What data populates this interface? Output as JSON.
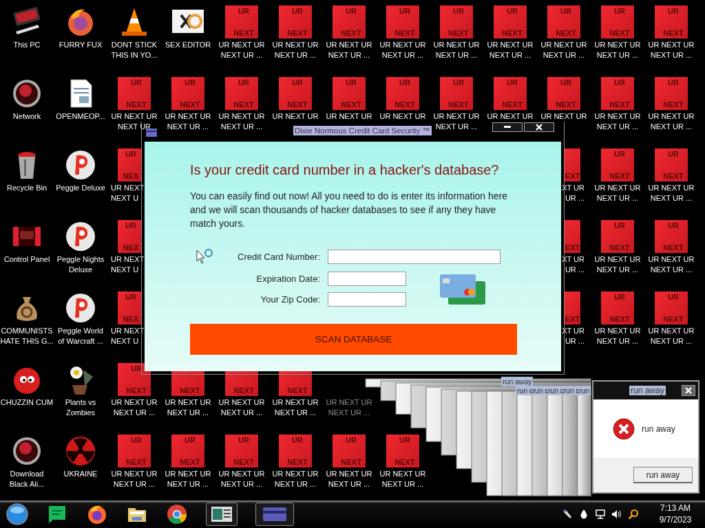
{
  "desktop": {
    "rows": [
      [
        {
          "kind": "pc",
          "label": "This PC"
        },
        {
          "kind": "fox",
          "label": "FURRY FUX"
        },
        {
          "kind": "cone",
          "label": "DONT STICK THIS IN YO..."
        },
        {
          "kind": "hxd",
          "label": "SEX EDITOR"
        },
        {
          "kind": "tile",
          "top": "UR",
          "bottom": "NEXT",
          "label": "UR NEXT UR NEXT UR ..."
        },
        {
          "kind": "tile",
          "top": "UR",
          "bottom": "NEXT",
          "label": "UR NEXT UR NEXT UR ..."
        },
        {
          "kind": "tile",
          "top": "UR",
          "bottom": "NEXT",
          "label": "UR NEXT UR NEXT UR ..."
        },
        {
          "kind": "tile",
          "top": "UR",
          "bottom": "NEXT",
          "label": "UR NEXT UR NEXT UR ..."
        },
        {
          "kind": "tile",
          "top": "UR",
          "bottom": "NEXT",
          "label": "UR NEXT UR NEXT UR ..."
        },
        {
          "kind": "tile",
          "top": "UR",
          "bottom": "NEXT",
          "label": "UR NEXT UR NEXT UR ..."
        },
        {
          "kind": "tile",
          "top": "UR",
          "bottom": "NEXT",
          "label": "UR NEXT UR NEXT UR ..."
        },
        {
          "kind": "tile",
          "top": "UR",
          "bottom": "NEXT",
          "label": "UR NEXT UR NEXT UR ..."
        },
        {
          "kind": "tile",
          "top": "UR",
          "bottom": "NEXT",
          "label": "UR NEXT UR NEXT UR ..."
        }
      ],
      [
        {
          "kind": "orb",
          "label": "Network"
        },
        {
          "kind": "doc",
          "label": "OPENMEOP..."
        },
        {
          "kind": "tile",
          "top": "UR",
          "bottom": "NEXT",
          "label": "UR NEXT UR NEXT UR"
        },
        {
          "kind": "tile",
          "top": "UR",
          "bottom": "NEXT",
          "label": "UR NEXT UR NEXT UR ..."
        },
        {
          "kind": "tile",
          "top": "UR",
          "bottom": "NEXT",
          "label": "UR NEXT UR NEXT UR ..."
        },
        {
          "kind": "tile",
          "top": "UR",
          "bottom": "NEXT",
          "label": "UR NEXT UR"
        },
        {
          "kind": "tile",
          "top": "UR",
          "bottom": "NEXT",
          "label": "UR NEXT UR"
        },
        {
          "kind": "tile",
          "top": "UR",
          "bottom": "NEXT",
          "label": "UR NEXT UR"
        },
        {
          "kind": "tile",
          "top": "UR",
          "bottom": "NEXT",
          "label": "UR NEXT UR NEXT UR ..."
        },
        {
          "kind": "tile",
          "top": "UR",
          "bottom": "NEXT",
          "label": "UR NEXT UR"
        },
        {
          "kind": "tile",
          "top": "UR",
          "bottom": "NEXT",
          "label": "UR NEXT UR"
        },
        {
          "kind": "tile",
          "top": "UR",
          "bottom": "NEXT",
          "label": "UR NEXT UR NEXT UR ..."
        },
        {
          "kind": "tile",
          "top": "UR",
          "bottom": "NEXT",
          "label": "UR NEXT UR NEXT UR ..."
        }
      ],
      [
        {
          "kind": "bin",
          "label": "Recycle Bin"
        },
        {
          "kind": "peggle",
          "label": "Peggle Deluxe"
        },
        {
          "kind": "tile-cut-left",
          "top": "UR",
          "bottom": "NEX",
          "label": "UR NEXT\nNEXT U"
        },
        {
          "kind": "covered"
        },
        {
          "kind": "covered"
        },
        {
          "kind": "covered"
        },
        {
          "kind": "covered"
        },
        {
          "kind": "covered"
        },
        {
          "kind": "covered"
        },
        {
          "kind": "covered"
        },
        {
          "kind": "tile-cut-right",
          "bottom": "EXT",
          "label": "XT UR\nUR ..."
        },
        {
          "kind": "tile",
          "top": "UR",
          "bottom": "NEXT",
          "label": "UR NEXT UR NEXT UR ..."
        },
        {
          "kind": "tile",
          "top": "UR",
          "bottom": "NEXT",
          "label": "UR NEXT UR NEXT UR ..."
        }
      ],
      [
        {
          "kind": "panel",
          "label": "Control Panel"
        },
        {
          "kind": "peggle",
          "label": "Peggle Nights Deluxe"
        },
        {
          "kind": "tile-cut-left",
          "top": "UR",
          "bottom": "NEX",
          "label": "UR NEXT\nNEXT U"
        },
        {
          "kind": "covered"
        },
        {
          "kind": "covered"
        },
        {
          "kind": "covered"
        },
        {
          "kind": "covered"
        },
        {
          "kind": "covered"
        },
        {
          "kind": "covered"
        },
        {
          "kind": "covered"
        },
        {
          "kind": "tile-cut-right",
          "bottom": "EXT",
          "label": "XT UR\nUR ..."
        },
        {
          "kind": "tile",
          "top": "UR",
          "bottom": "NEXT",
          "label": "UR NEXT UR NEXT UR ..."
        },
        {
          "kind": "tile",
          "top": "UR",
          "bottom": "NEXT",
          "label": "UR NEXT UR NEXT UR ..."
        }
      ],
      [
        {
          "kind": "bag",
          "label": "COMMUNISTS HATE THIS G..."
        },
        {
          "kind": "peggle",
          "label": "Peggle World of Warcraft ..."
        },
        {
          "kind": "tile-cut-left",
          "top": "UR",
          "bottom": "NEX",
          "label": "UR NEXT\nNEXT U"
        },
        {
          "kind": "covered"
        },
        {
          "kind": "covered"
        },
        {
          "kind": "covered"
        },
        {
          "kind": "covered"
        },
        {
          "kind": "covered"
        },
        {
          "kind": "covered"
        },
        {
          "kind": "covered"
        },
        {
          "kind": "tile-cut-right",
          "bottom": "EXT",
          "label": "XT UR\nUR ..."
        },
        {
          "kind": "tile",
          "top": "UR",
          "bottom": "NEXT",
          "label": "UR NEXT UR NEXT UR ..."
        },
        {
          "kind": "tile",
          "top": "UR",
          "bottom": "NEXT",
          "label": "UR NEXT UR NEXT UR ..."
        }
      ],
      [
        {
          "kind": "fuzz",
          "label": "CHUZZIN CUM"
        },
        {
          "kind": "flower",
          "label": "Plants vs Zombies"
        },
        {
          "kind": "tile",
          "top": "UR",
          "bottom": "NEXT",
          "label": "UR NEXT UR NEXT UR ..."
        },
        {
          "kind": "tile",
          "bottom": "NEXT",
          "label": "UR NEXT UR NEXT UR ..."
        },
        {
          "kind": "tile",
          "bottom": "NEXT",
          "label": "UR NEXT UR NEXT UR ..."
        },
        {
          "kind": "tile",
          "bottom": "NEXT",
          "label": "UR NEXT UR NEXT UR ..."
        },
        {
          "kind": "label-only",
          "label": "UR NEXT UR NEXT UR ..."
        },
        {
          "kind": "covered"
        },
        {
          "kind": "covered"
        },
        {
          "kind": "covered"
        },
        {
          "kind": "covered"
        },
        {
          "kind": "covered"
        },
        {
          "kind": "covered"
        }
      ],
      [
        {
          "kind": "orb",
          "label": "Download Black Ali..."
        },
        {
          "kind": "radiation",
          "label": "UKRAINE"
        },
        {
          "kind": "tile",
          "top": "UR",
          "bottom": "NEXT",
          "label": "UR NEXT UR NEXT UR ..."
        },
        {
          "kind": "tile",
          "top": "UR",
          "bottom": "NEXT",
          "label": "UR NEXT UR NEXT UR ..."
        },
        {
          "kind": "tile",
          "top": "UR",
          "bottom": "NEXT",
          "label": "UR NEXT UR NEXT UR ..."
        },
        {
          "kind": "tile",
          "top": "UR",
          "bottom": "NEXT",
          "label": "UR NEXT UR NEXT UR ..."
        },
        {
          "kind": "tile",
          "top": "UR",
          "bottom": "NEXT",
          "label": "UR NEXT UR NEXT UR ..."
        },
        {
          "kind": "tile",
          "top": "UR",
          "bottom": "NEXT",
          "label": "UR NEXT UR NEXT UR ..."
        },
        {
          "kind": "covered"
        },
        {
          "kind": "covered"
        },
        {
          "kind": "covered"
        },
        {
          "kind": "covered"
        },
        {
          "kind": "covered"
        }
      ]
    ]
  },
  "dialog": {
    "title": "Dixie Normous Credit Card Security ™",
    "heading": "Is your credit card number in a hacker's database?",
    "body": "You can easily find out now! All you need to do is enter its information here and we will scan thousands of hacker databases to see if any they have match yours.",
    "fields": [
      {
        "label": "Credit Card Number:",
        "kind": "long"
      },
      {
        "label": "Expiration Date:",
        "kind": "short"
      },
      {
        "label": "Your Zip Code:",
        "kind": "short"
      }
    ],
    "button": "SCAN DATABASE"
  },
  "trail": {
    "texts": [
      "run away",
      "run ɛrun ɛrun ɛrun ɛrun"
    ]
  },
  "alert": {
    "title": "run away",
    "message": "run away",
    "button": "run away"
  },
  "taskbar": {
    "apps": [
      {
        "kind": "orb"
      },
      {
        "kind": "chat"
      },
      {
        "kind": "firefox"
      },
      {
        "kind": "folder"
      },
      {
        "kind": "chrome"
      },
      {
        "kind": "window"
      },
      {
        "kind": "card"
      }
    ],
    "tray": [
      {
        "kind": "flashlight"
      },
      {
        "kind": "drop"
      },
      {
        "kind": "network"
      },
      {
        "kind": "volume"
      },
      {
        "kind": "search"
      }
    ],
    "time": "7:13 AM",
    "date": "9/7/2023"
  }
}
